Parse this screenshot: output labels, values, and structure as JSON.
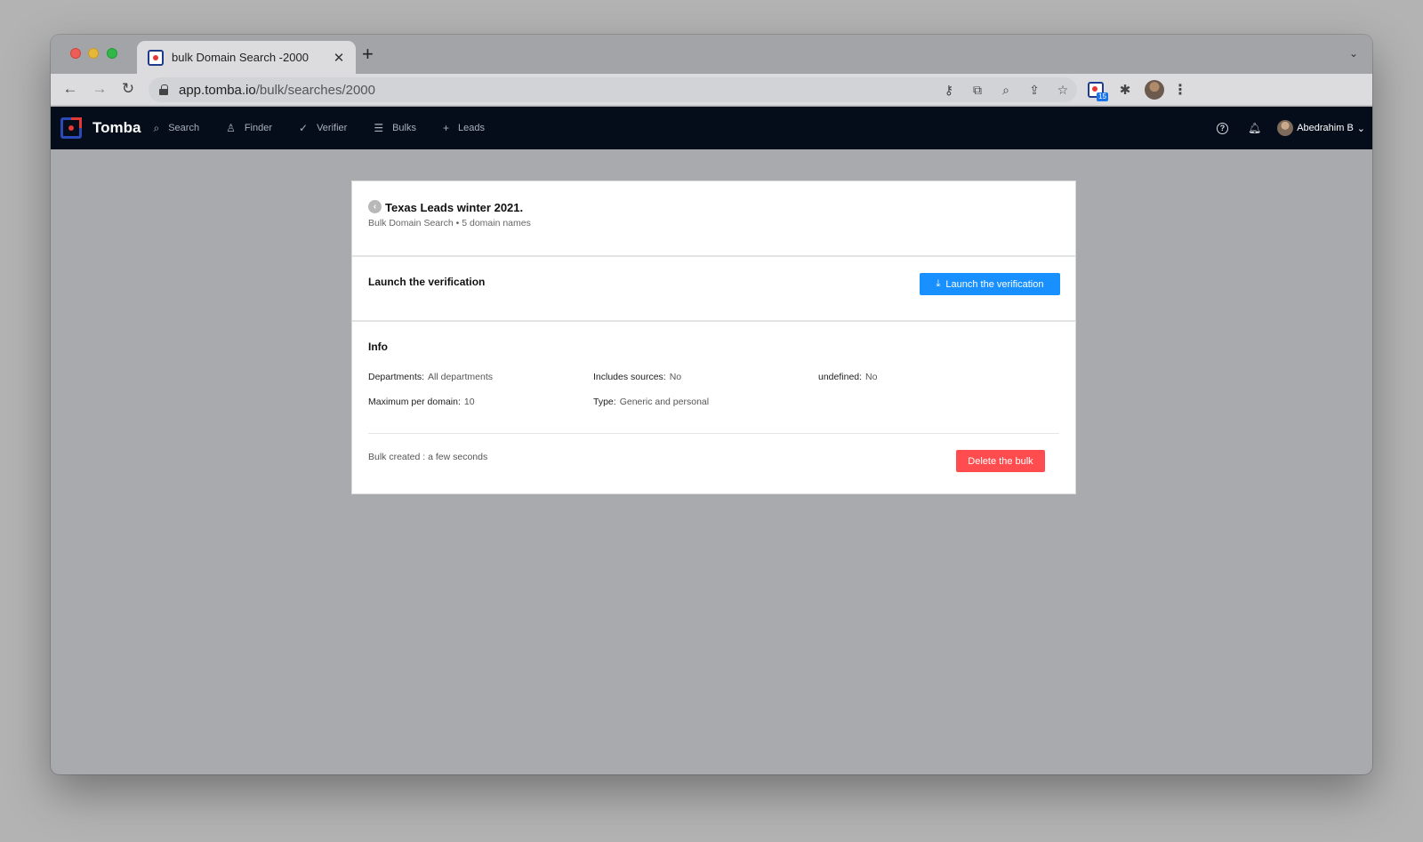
{
  "browser": {
    "tab": {
      "title": "bulk Domain Search -2000",
      "close": "✕"
    },
    "new_tab": "+",
    "url": {
      "domain": "app.tomba.io",
      "path": "/bulk/searches/2000"
    },
    "extension_badge": "15"
  },
  "app": {
    "logo": "Tomba",
    "nav": [
      {
        "label": "Search",
        "icon": "search-icon"
      },
      {
        "label": "Finder",
        "icon": "user-icon"
      },
      {
        "label": "Verifier",
        "icon": "check-icon"
      },
      {
        "label": "Bulks",
        "icon": "list-icon"
      },
      {
        "label": "Leads",
        "icon": "plus-icon"
      }
    ],
    "user": {
      "name": "Abedrahim B"
    }
  },
  "bulk": {
    "title": "Texas Leads winter 2021.",
    "subtitle": "Bulk Domain Search • 5 domain names",
    "launch_section_title": "Launch the verification",
    "launch_button": "Launch the verification",
    "info_title": "Info",
    "info": {
      "departments_label": "Departments:",
      "departments_value": "All departments",
      "includes_sources_label": "Includes sources:",
      "includes_sources_value": "No",
      "undefined_label": "undefined:",
      "undefined_value": "No",
      "max_per_domain_label": "Maximum per domain:",
      "max_per_domain_value": "10",
      "type_label": "Type:",
      "type_value": "Generic and personal"
    },
    "created": "Bulk created : a few seconds",
    "delete_button": "Delete the bulk"
  },
  "colors": {
    "primary": "#1890ff",
    "danger": "#ff4d4f",
    "appbar": "#050d1b",
    "brand_red": "#e53935",
    "brand_blue": "#2b4ab8"
  }
}
